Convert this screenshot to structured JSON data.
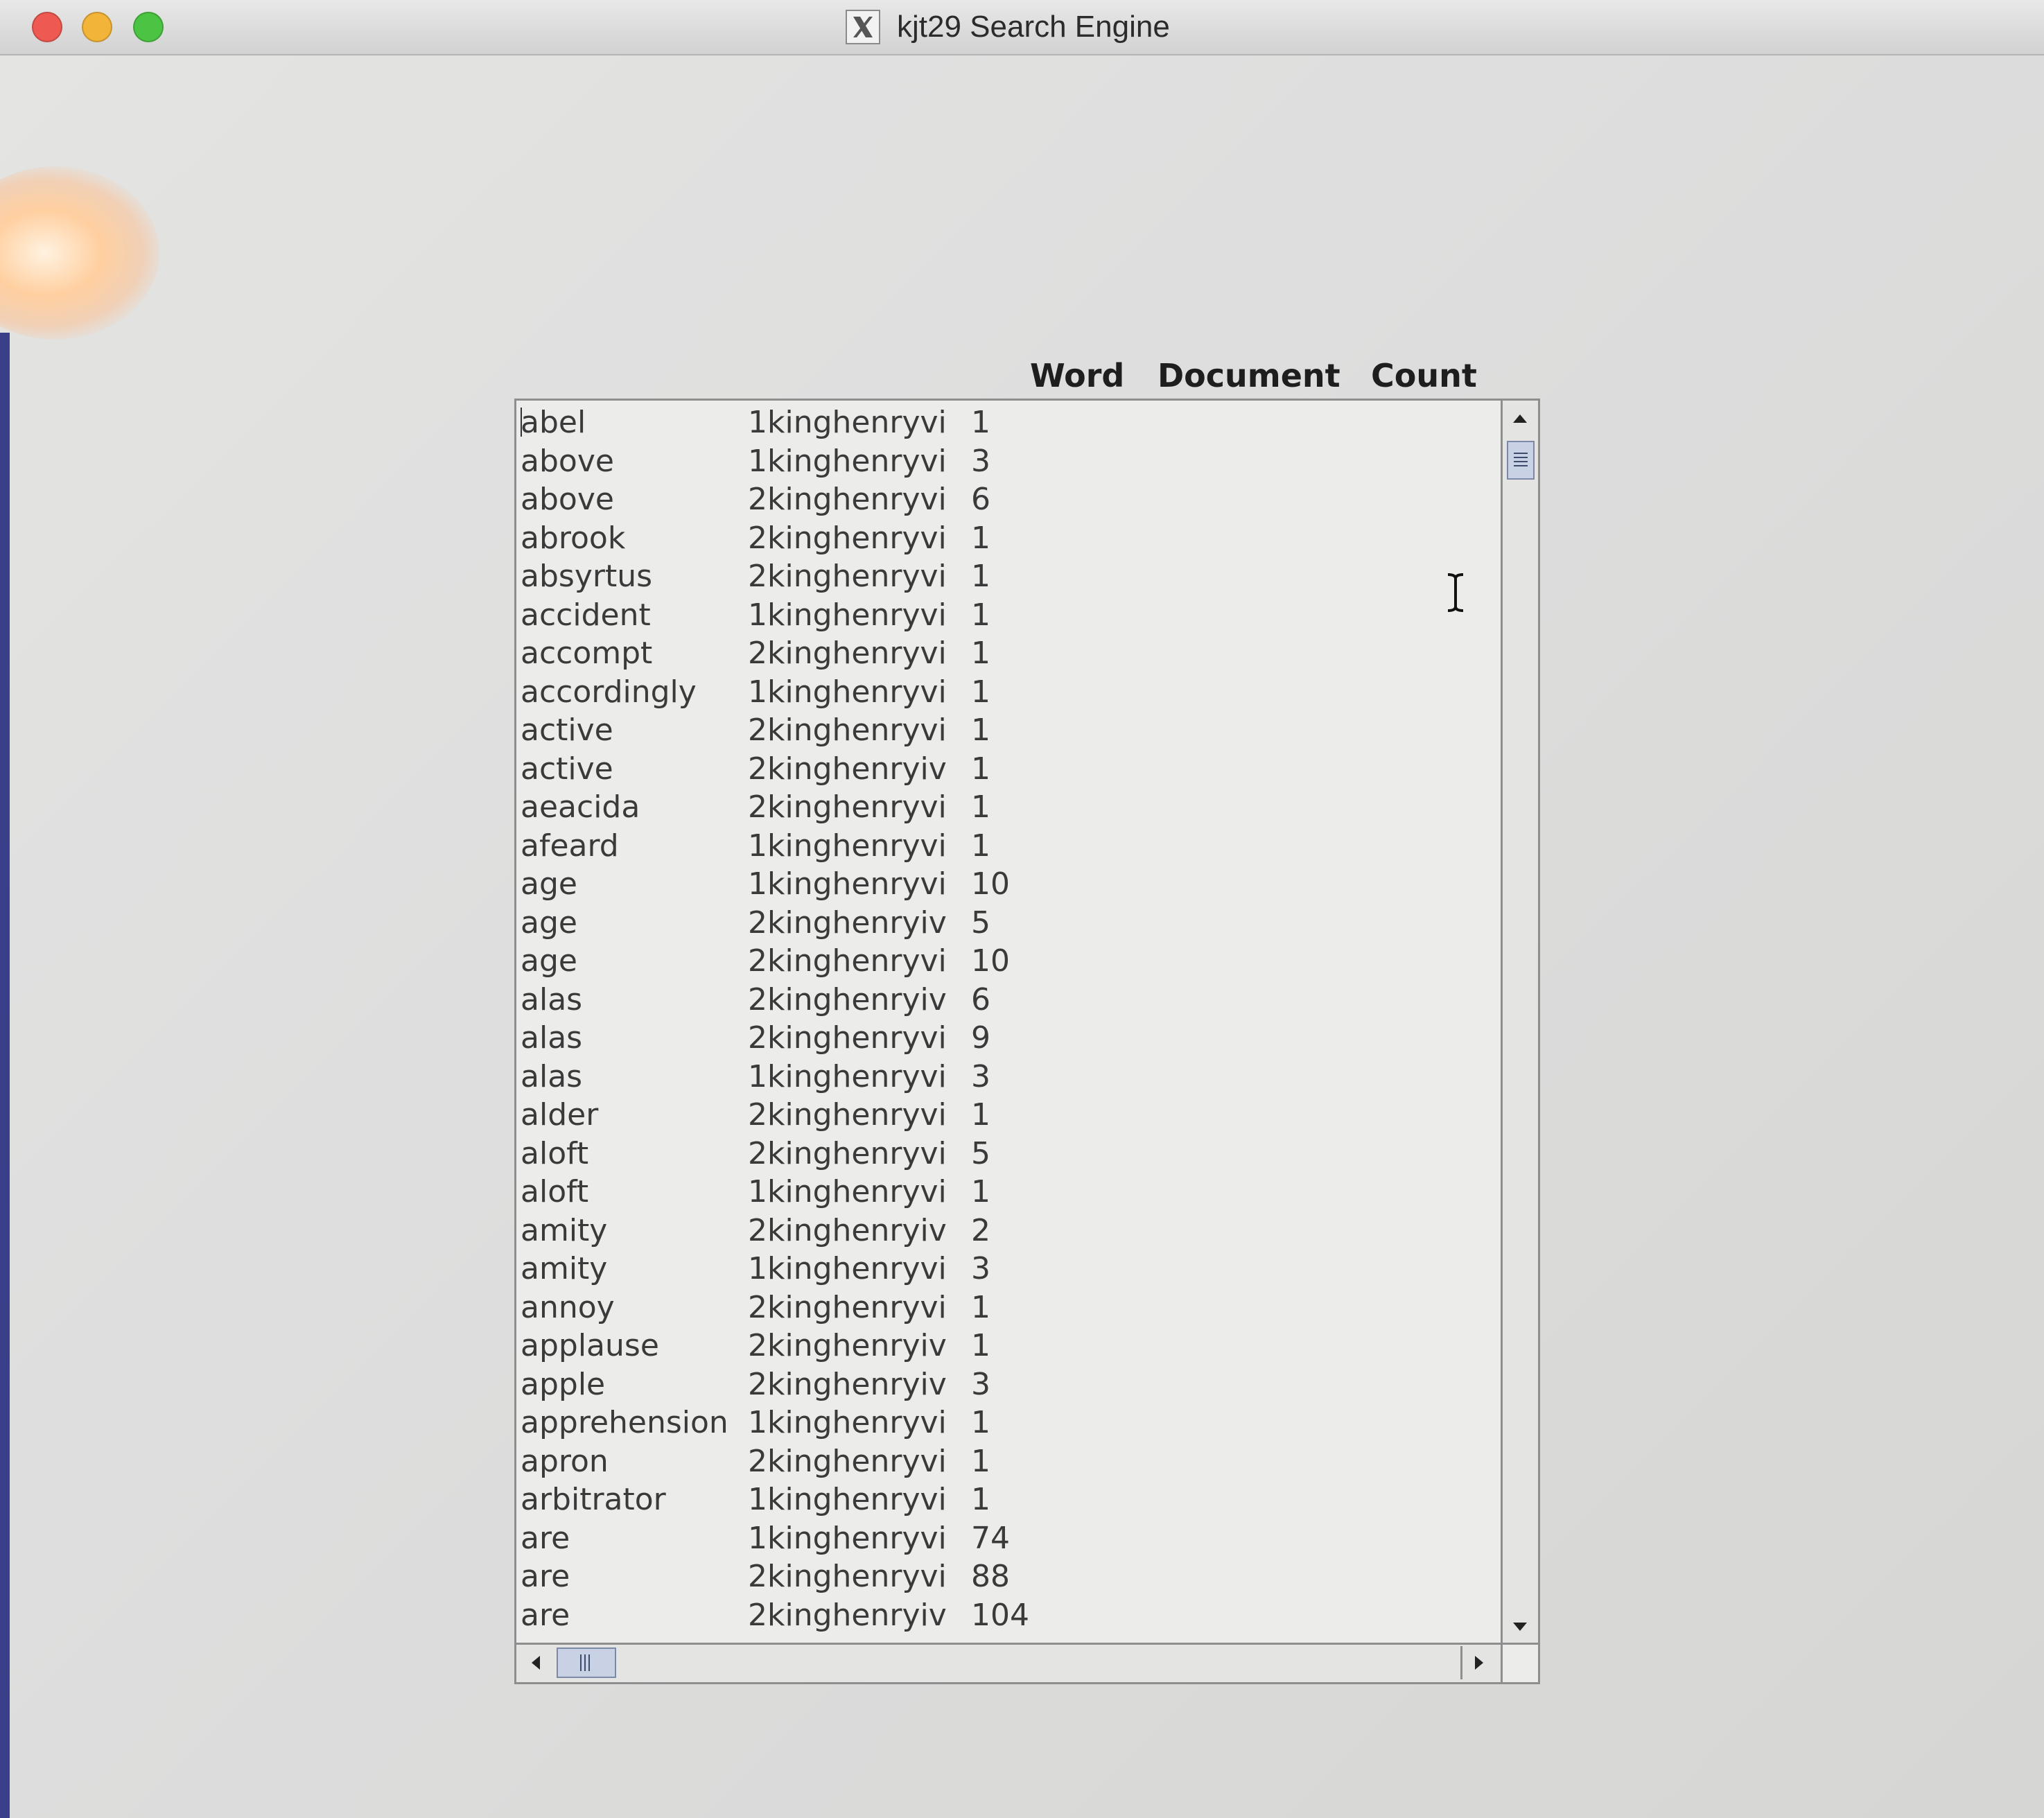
{
  "window": {
    "title": "kjt29 Search Engine",
    "app_icon": "x11-icon"
  },
  "columns": {
    "word": "Word",
    "document": "Document",
    "count": "Count"
  },
  "rows": [
    {
      "word": "abel",
      "document": "1kinghenryvi",
      "count": "1"
    },
    {
      "word": "above",
      "document": "1kinghenryvi",
      "count": "3"
    },
    {
      "word": "above",
      "document": "2kinghenryvi",
      "count": "6"
    },
    {
      "word": "abrook",
      "document": "2kinghenryvi",
      "count": "1"
    },
    {
      "word": "absyrtus",
      "document": "2kinghenryvi",
      "count": "1"
    },
    {
      "word": "accident",
      "document": "1kinghenryvi",
      "count": "1"
    },
    {
      "word": "accompt",
      "document": "2kinghenryvi",
      "count": "1"
    },
    {
      "word": "accordingly",
      "document": "1kinghenryvi",
      "count": "1"
    },
    {
      "word": "active",
      "document": "2kinghenryvi",
      "count": "1"
    },
    {
      "word": "active",
      "document": "2kinghenryiv",
      "count": "1"
    },
    {
      "word": "aeacida",
      "document": "2kinghenryvi",
      "count": "1"
    },
    {
      "word": "afeard",
      "document": "1kinghenryvi",
      "count": "1"
    },
    {
      "word": "age",
      "document": "1kinghenryvi",
      "count": "10"
    },
    {
      "word": "age",
      "document": "2kinghenryiv",
      "count": "5"
    },
    {
      "word": "age",
      "document": "2kinghenryvi",
      "count": "10"
    },
    {
      "word": "alas",
      "document": "2kinghenryiv",
      "count": "6"
    },
    {
      "word": "alas",
      "document": "2kinghenryvi",
      "count": "9"
    },
    {
      "word": "alas",
      "document": "1kinghenryvi",
      "count": "3"
    },
    {
      "word": "alder",
      "document": "2kinghenryvi",
      "count": "1"
    },
    {
      "word": "aloft",
      "document": "2kinghenryvi",
      "count": "5"
    },
    {
      "word": "aloft",
      "document": "1kinghenryvi",
      "count": "1"
    },
    {
      "word": "amity",
      "document": "2kinghenryiv",
      "count": "2"
    },
    {
      "word": "amity",
      "document": "1kinghenryvi",
      "count": "3"
    },
    {
      "word": "annoy",
      "document": "2kinghenryvi",
      "count": "1"
    },
    {
      "word": "applause",
      "document": "2kinghenryiv",
      "count": "1"
    },
    {
      "word": "apple",
      "document": "2kinghenryiv",
      "count": "3"
    },
    {
      "word": "apprehension",
      "document": "1kinghenryvi",
      "count": "1"
    },
    {
      "word": "apron",
      "document": "2kinghenryvi",
      "count": "1"
    },
    {
      "word": "arbitrator",
      "document": "1kinghenryvi",
      "count": "1"
    },
    {
      "word": "are",
      "document": "1kinghenryvi",
      "count": "74"
    },
    {
      "word": "are",
      "document": "2kinghenryvi",
      "count": "88"
    },
    {
      "word": "are",
      "document": "2kinghenryiv",
      "count": "104"
    }
  ],
  "colors": {
    "traffic_close": "#ee5a52",
    "traffic_minimize": "#f3b43a",
    "traffic_zoom": "#4cc443",
    "scroll_thumb": "#c8d2e4"
  }
}
